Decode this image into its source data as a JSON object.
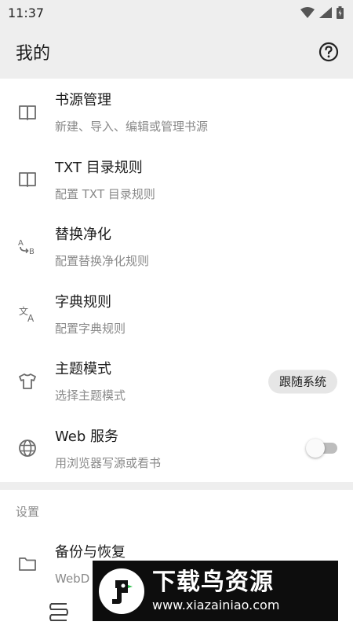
{
  "status": {
    "time": "11:37"
  },
  "header": {
    "title": "我的"
  },
  "items": [
    {
      "title": "书源管理",
      "subtitle": "新建、导入、编辑或管理书源",
      "icon": "book-icon"
    },
    {
      "title": "TXT 目录规则",
      "subtitle": "配置 TXT 目录规则",
      "icon": "book-icon"
    },
    {
      "title": "替换净化",
      "subtitle": "配置替换净化规则",
      "icon": "replace-ab-icon"
    },
    {
      "title": "字典规则",
      "subtitle": "配置字典规则",
      "icon": "translate-icon"
    },
    {
      "title": "主题模式",
      "subtitle": "选择主题模式",
      "icon": "tshirt-icon",
      "chip": "跟随系统"
    },
    {
      "title": "Web 服务",
      "subtitle": "用浏览器写源或看书",
      "icon": "globe-icon",
      "switch_on": false
    },
    {
      "title": "备份与恢复",
      "subtitle": "WebD",
      "icon": "folder-icon"
    }
  ],
  "section": {
    "settings_label": "设置"
  },
  "watermark": {
    "title": "下载鸟资源",
    "url": "www.xiazainiao.com"
  }
}
